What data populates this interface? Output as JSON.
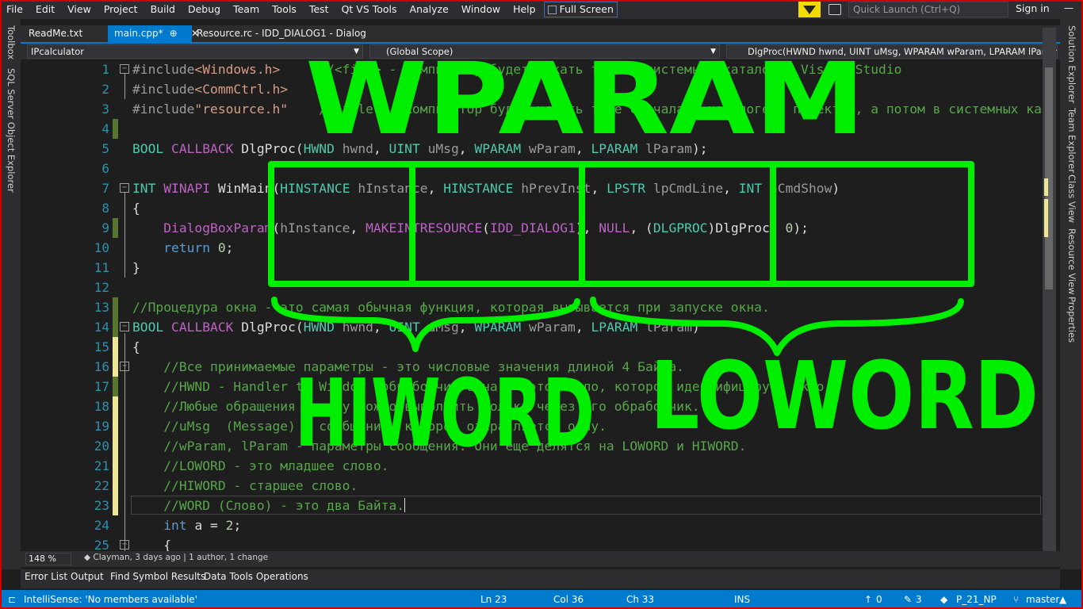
{
  "menu": [
    "File",
    "Edit",
    "View",
    "Project",
    "Build",
    "Debug",
    "Team",
    "Tools",
    "Test",
    "Qt VS Tools",
    "Analyze",
    "Window",
    "Help"
  ],
  "fullscreen_label": "Full Screen",
  "quick_launch_placeholder": "Quick Launch (Ctrl+Q)",
  "sign_in": "Sign in",
  "left_tools": [
    "Toolbox",
    "SQL Server Object Explorer"
  ],
  "right_tools": [
    "Solution Explorer",
    "Team Explorer",
    "Class View",
    "Resource View",
    "Properties"
  ],
  "tabs": [
    "ReadMe.txt",
    "main.cpp*",
    "Resource.rc - IDD_DIALOG1 - Dialog"
  ],
  "nav": {
    "project": "IPcalculator",
    "scope": "(Global Scope)",
    "member": "DlgProc(HWND hwnd, UINT uMsg, WPARAM wParam, LPARAM lParam)"
  },
  "line_numbers": [
    "1",
    "2",
    "3",
    "4",
    "5",
    "6",
    "7",
    "8",
    "9",
    "10",
    "11",
    "12",
    "13",
    "14",
    "15",
    "16",
    "17",
    "18",
    "19",
    "20",
    "21",
    "22",
    "23",
    "24",
    "25"
  ],
  "code": [
    "#include<Windows.h>     //<file> - компилятор будет искать file в системных каталогах Visual Studio",
    "#include<CommCtrl.h>",
    "#include\"resource.h\"    //\"file\" - компилятор будет искать file сначала в каталоге с проектом, а потом в системных каталогах",
    "",
    "BOOL CALLBACK DlgProc(HWND hwnd, UINT uMsg, WPARAM wParam, LPARAM lParam);",
    "",
    "INT WINAPI WinMain(HINSTANCE hInstance, HINSTANCE hPrevInst, LPSTR lpCmdLine, INT nCmdShow)",
    "{",
    "    DialogBoxParam(hInstance, MAKEINTRESOURCE(IDD_DIALOG1), NULL, (DLGPROC)DlgProc, 0);",
    "    return 0;",
    "}",
    "",
    "//Процедура окна - это самая обычная функция, которая вызывается при запуске окна.",
    "BOOL CALLBACK DlgProc(HWND hwnd, UINT uMsg, WPARAM wParam, LPARAM lParam)",
    "{",
    "    //Все принимаемые параметры - это числовые значения длиной 4 Байта.",
    "    //HWND - Handler to Window (обработчик окна) - это число, которое идентифицирует окно.",
    "    //Любые обращения к окну можно выполнить только через его обработчик.",
    "    //uMsg  (Message) - сообщение, которое отправляется окну.",
    "    //wParam, lParam - параметры сообщения. Они еще делятся на LOWORD и HIWORD.",
    "    //LOWORD - это младшее слово.",
    "    //HIWORD - старшее слово.",
    "    //WORD (Слово) - это два Байта.",
    "    int a = 2;",
    "    {"
  ],
  "editor_status": {
    "zoom": "148 %",
    "codelens": "Clayman, 3 days ago | 1 author, 1 change"
  },
  "bottom_tabs": [
    "Error List",
    "Output",
    "Find Symbol Results",
    "Data Tools Operations"
  ],
  "statusbar": {
    "message": "IntelliSense: 'No members available'",
    "ln": "Ln 23",
    "col": "Col 36",
    "ch": "Ch 33",
    "ins": "INS",
    "up": "0",
    "edits": "3",
    "repo": "P_21_NP",
    "branch": "master"
  },
  "annotations": {
    "top": "WPARAM",
    "left": "HIWORD",
    "right": "LOWORD"
  },
  "colors": {
    "annotation": "#00ee00",
    "accent": "#007acc",
    "frame": "#d40000"
  }
}
